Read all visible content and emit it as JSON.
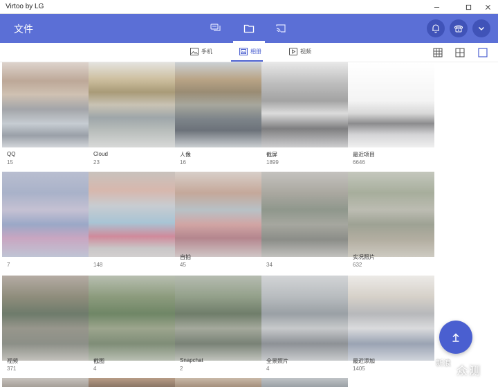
{
  "window": {
    "title": "Virtoo by LG",
    "controls": [
      "minimize-icon",
      "maximize-icon",
      "close-icon"
    ]
  },
  "header": {
    "title": "文件",
    "tabs": [
      {
        "icon": "messages-icon",
        "active": false
      },
      {
        "icon": "folder-icon",
        "active": true
      },
      {
        "icon": "screen-cast-icon",
        "active": false
      }
    ],
    "actions": [
      "bell-icon",
      "phone-icon",
      "chevron-down-icon"
    ]
  },
  "subtabs": [
    {
      "label": "手机",
      "icon": "image-icon",
      "active": false
    },
    {
      "label": "相册",
      "icon": "gallery-icon",
      "active": true
    },
    {
      "label": "视频",
      "icon": "video-icon",
      "active": false
    }
  ],
  "view_options": [
    "grid-small-icon",
    "grid-large-icon",
    "grid-single-icon"
  ],
  "albums": [
    {
      "name": "QQ",
      "count": "15"
    },
    {
      "name": "Cloud",
      "count": "23"
    },
    {
      "name": "人像",
      "count": "16"
    },
    {
      "name": "截屏",
      "count": "1899"
    },
    {
      "name": "最近项目",
      "count": "6646"
    },
    {
      "name": "",
      "count": "7"
    },
    {
      "name": "",
      "count": "148"
    },
    {
      "name": "自拍",
      "count": "45"
    },
    {
      "name": "",
      "count": "34"
    },
    {
      "name": "实况照片",
      "count": "632"
    },
    {
      "name": "视频",
      "count": "371"
    },
    {
      "name": "截图",
      "count": "4"
    },
    {
      "name": "Snapchat",
      "count": "2"
    },
    {
      "name": "全景照片",
      "count": "4"
    },
    {
      "name": "最近添加",
      "count": "1405"
    }
  ],
  "fab": {
    "icon": "upload-icon"
  },
  "watermark": {
    "logo": "新浪",
    "text": "众测"
  },
  "colors": {
    "primary": "#5b6fd6",
    "accent": "#4a5fd0",
    "dark_button": "#4053b8"
  }
}
